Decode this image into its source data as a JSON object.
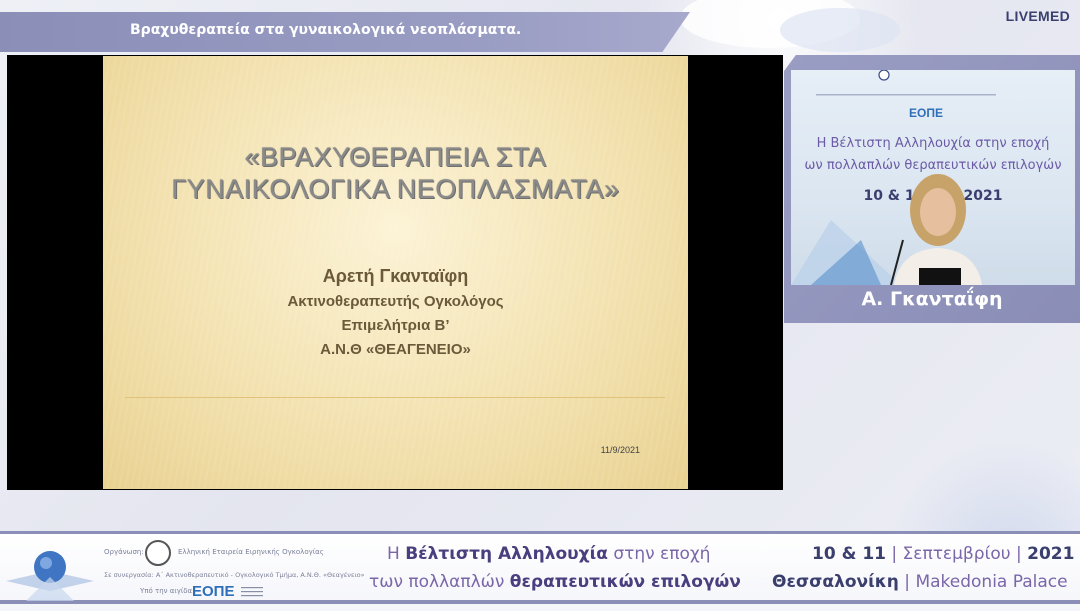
{
  "brand": "LIVEMED",
  "title_bar": {
    "text": "Βραχυθεραπεία στα γυναικολογικά νεοπλάσματα."
  },
  "slide": {
    "heading_line1": "«ΒΡΑΧΥΘΕΡΑΠΕΙΑ ΣΤΑ",
    "heading_line2": "ΓΥΝΑΙΚΟΛΟΓΙΚΑ ΝΕΟΠΛΑΣΜΑΤΑ»",
    "author": "Αρετή Γκανταϊφη",
    "role": "Ακτινοθεραπευτής Ογκολόγος",
    "position": "Επιμελήτρια Β’",
    "hospital": "Α.Ν.Θ «ΘΕΑΓΕΝΕΙΟ»",
    "date": "11/9/2021"
  },
  "camera": {
    "banner_line1": "Η Βέλτιστη Αλληλουχία στην εποχή",
    "banner_line2": "ων πολλαπλών θεραπευτικών επιλογών",
    "banner_line3": "10 & 11 |        υ | 2021",
    "logo": "ΕΟΠΕ"
  },
  "speaker_name": "Α. Γκανταΐφη",
  "footer": {
    "org_label": "Οργάνωση:",
    "org_name": "Ελληνική Εταιρεία Ειρηνικής Ογκολογίας",
    "cooperation": "Σε συνεργασία: Α΄ Ακτινοθεραπευτικό - Ογκολογικό Τμήμα, Α.Ν.Θ. «Θεαγένειο»",
    "auspices": "Υπό την αιγίδα:",
    "logo": "ΕΟΠΕ",
    "headline_line1_pre": "Η",
    "headline_line1_bold": "Βέλτιστη Αλληλουχία",
    "headline_line1_post": "στην εποχή",
    "headline_line2_pre": "των πολλαπλών",
    "headline_line2_bold": "θεραπευτικών επιλογών",
    "dates_bold_1": "10 & 11",
    "dates_sep_1": " | ",
    "dates_month": "Σεπτεμβρίου",
    "dates_sep_2": " | ",
    "dates_year": "2021",
    "city": "Θεσσαλονίκη",
    "city_sep": " | ",
    "venue": "Makedonia Palace"
  }
}
